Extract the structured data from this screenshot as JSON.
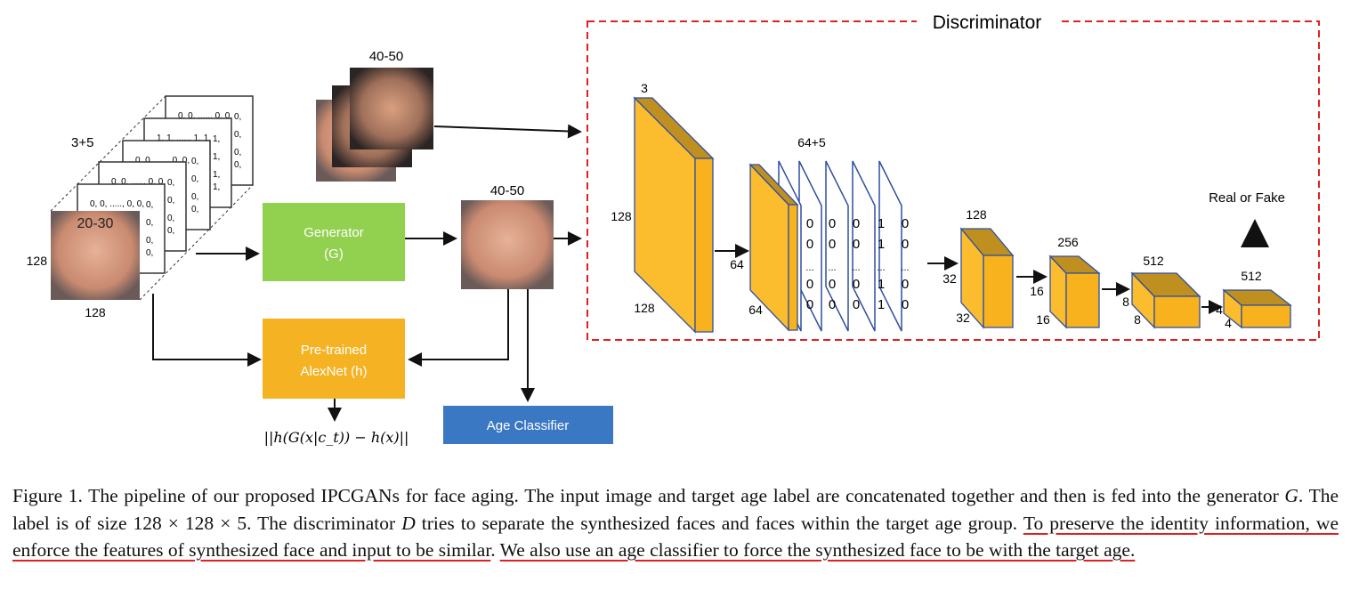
{
  "input": {
    "age_label": "20-30",
    "channels": "3+5",
    "width": "128",
    "height": "128",
    "plane_rows": [
      "0, 0,  ....., 0, 0,",
      "0, 0,  ....., 0, 0,",
      "0, 0,  ....., 0, 0,",
      "1, 1,  ....., 1, 1,",
      "0, 0,  ....., 0, 0,"
    ],
    "plane_col": [
      "0,",
      "0,",
      "0,",
      "1,",
      "0,"
    ]
  },
  "generator": {
    "label": "Generator",
    "sub": "(G)",
    "color": "#92d050"
  },
  "alexnet": {
    "label": "Pre-trained",
    "sub": "AlexNet (h)",
    "color": "#f5b324"
  },
  "age_classifier": {
    "label": "Age Classifier",
    "color": "#3a78c3"
  },
  "loss": "||h(G(x|c_t)) − h(x)||",
  "output_age": "40-50",
  "real_age": "40-50",
  "discriminator": {
    "title": "Discriminator",
    "border_color": "#e02020",
    "labels": {
      "l1_c": "3",
      "l1_h": "128",
      "l1_w": "128",
      "l2_c": "64+5",
      "l2_h": "64",
      "l2_w": "64",
      "l3_c": "128",
      "l3_h": "32",
      "l3_w": "32",
      "l4_c": "256",
      "l4_h": "16",
      "l4_w": "16",
      "l5_c": "512",
      "l5_h": "8",
      "l5_w": "8",
      "l6_c": "512",
      "l6_h": "4",
      "l6_w": "4"
    },
    "label_columns": [
      [
        "0",
        "0",
        "...",
        "0",
        "0"
      ],
      [
        "0",
        "0",
        "...",
        "0",
        "0"
      ],
      [
        "0",
        "0",
        "...",
        "0",
        "0"
      ],
      [
        "1",
        "1",
        "...",
        "1",
        "1"
      ],
      [
        "0",
        "0",
        "...",
        "0",
        "0"
      ]
    ],
    "output": "Real or Fake"
  },
  "caption": {
    "p1": "Figure 1. The pipeline of our proposed IPCGANs for face aging. The input image and target age label are concatenated together and then is fed into the generator ",
    "G": "G",
    "p2": ". The label is of size 128 × 128 × 5. The discriminator ",
    "D": "D",
    "p3": " tries to separate the synthesized faces and faces within the target age group. ",
    "u1": "To preserve the identity information, we enforce the features of synthesized face and input to be similar",
    "p4": ". ",
    "u2": "We also use an age classifier to force the synthesized face to be with the target age."
  }
}
